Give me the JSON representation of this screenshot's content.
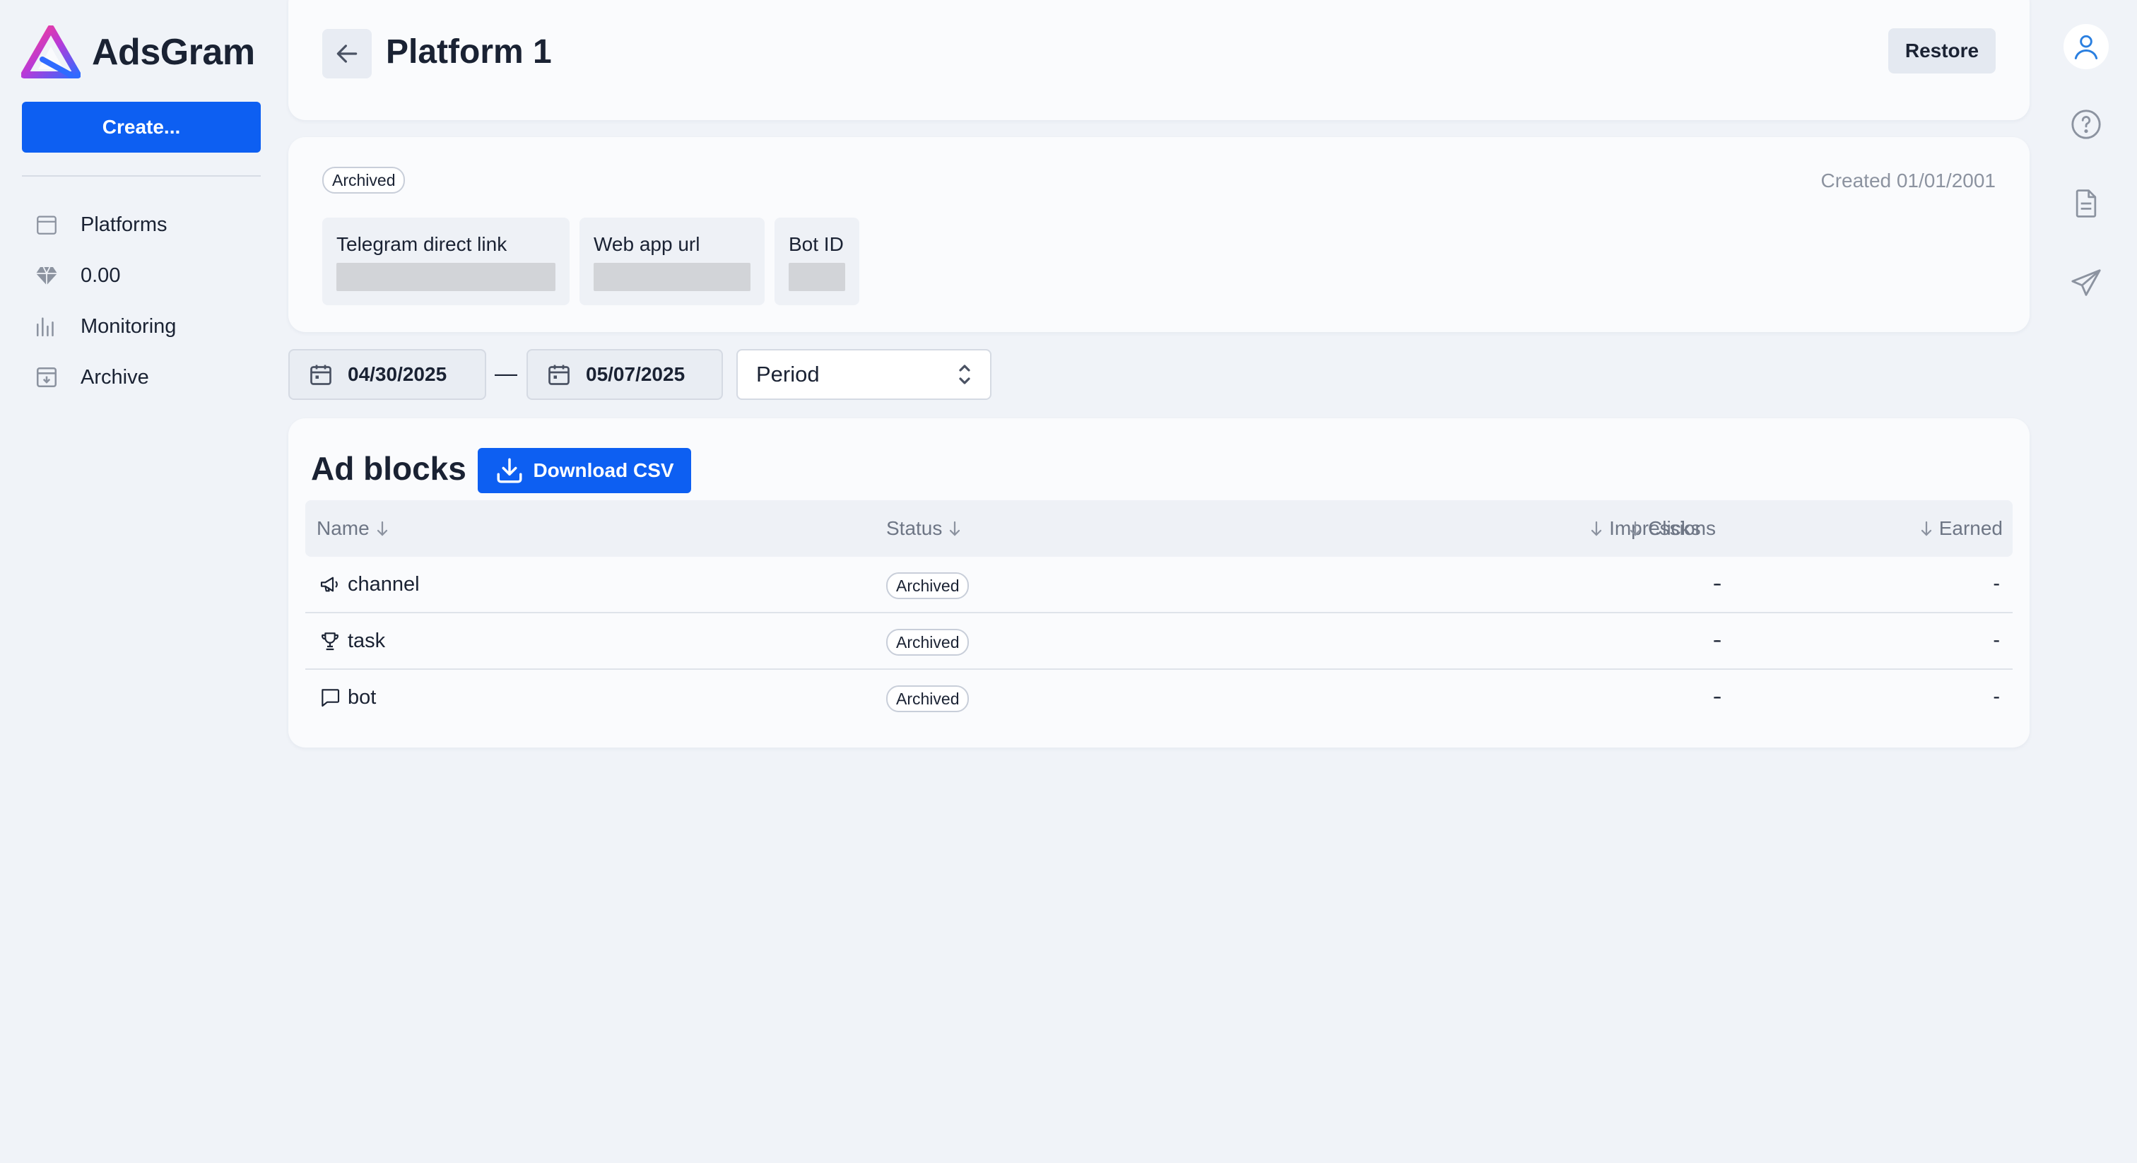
{
  "brand": {
    "name": "AdsGram"
  },
  "sidebar": {
    "create_label": "Create...",
    "items": [
      {
        "label": "Platforms",
        "icon": "calendar-icon"
      },
      {
        "label": "0.00",
        "icon": "diamond-icon"
      },
      {
        "label": "Monitoring",
        "icon": "bar-chart-icon"
      },
      {
        "label": "Archive",
        "icon": "archive-icon"
      }
    ]
  },
  "header": {
    "title": "Platform 1",
    "restore_label": "Restore"
  },
  "platform": {
    "status": "Archived",
    "created": "Created 01/01/2001",
    "fields": [
      {
        "label": "Telegram direct link"
      },
      {
        "label": "Web app url"
      },
      {
        "label": "Bot ID"
      }
    ]
  },
  "filters": {
    "date_from": "04/30/2025",
    "date_separator": "—",
    "date_to": "05/07/2025",
    "period": "Period"
  },
  "ad_blocks": {
    "title": "Ad blocks",
    "download_label": "Download CSV",
    "columns": {
      "name": "Name",
      "status": "Status",
      "impressions": "Impressions",
      "clicks": "Clicks",
      "earned": "Earned"
    },
    "rows": [
      {
        "icon": "megaphone-icon",
        "name": "channel",
        "status": "Archived",
        "impressions": "-",
        "clicks": "-",
        "earned": "-"
      },
      {
        "icon": "trophy-icon",
        "name": "task",
        "status": "Archived",
        "impressions": "-",
        "clicks": "-",
        "earned": "-"
      },
      {
        "icon": "chat-bubble-icon",
        "name": "bot",
        "status": "Archived",
        "impressions": "-",
        "clicks": "-",
        "earned": "-"
      }
    ]
  },
  "colors": {
    "primary": "#0d5ff2",
    "background": "#f0f3f8",
    "card": "#fafbfd",
    "text": "#1a2233",
    "muted": "#8c93a0"
  }
}
